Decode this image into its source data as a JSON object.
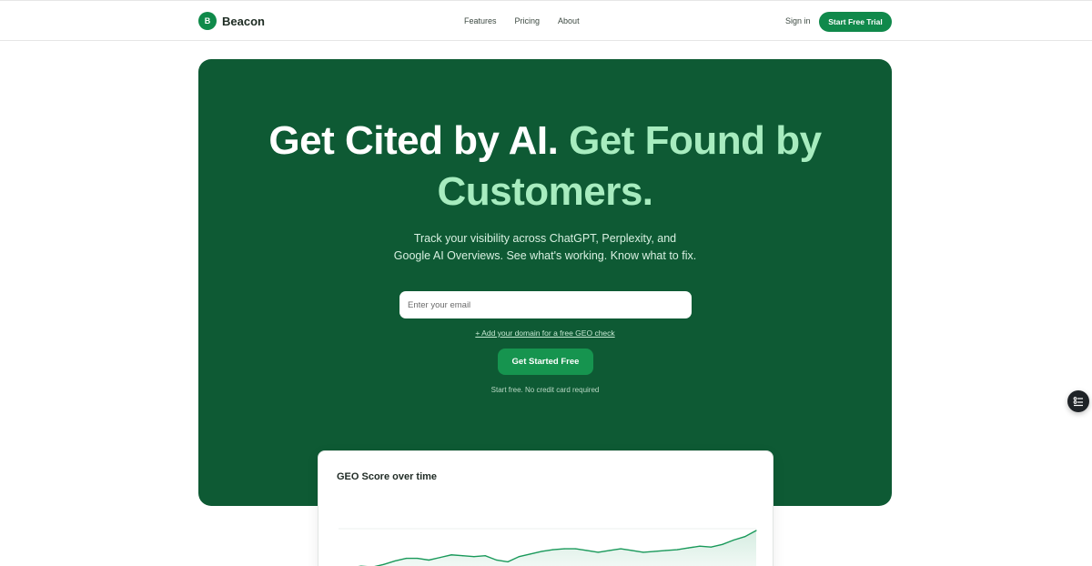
{
  "brand": {
    "initial": "B",
    "name": "Beacon"
  },
  "nav": {
    "links": [
      "Features",
      "Pricing",
      "About"
    ],
    "sign_in": "Sign in",
    "cta": "Start Free Trial"
  },
  "hero": {
    "headline_part1": "Get Cited by AI.",
    "headline_part2": "Get Found by Customers.",
    "subtitle_line1": "Track your visibility across ChatGPT, Perplexity, and",
    "subtitle_line2": "Google AI Overviews. See what's working. Know what to fix.",
    "email_placeholder": "Enter your email",
    "domain_link": "+ Add your domain for a free GEO check",
    "cta": "Get Started Free",
    "fineprint": "Start free. No credit card required"
  },
  "chart_data": {
    "type": "area",
    "title": "GEO Score over time",
    "xlabel": "",
    "ylabel": "",
    "grid": true,
    "values": [
      0,
      2,
      4,
      3,
      6,
      10,
      13,
      13,
      11,
      14,
      17,
      16,
      15,
      16,
      11,
      9,
      15,
      18,
      21,
      23,
      24,
      24,
      22,
      20,
      22,
      24,
      22,
      20,
      21,
      22,
      23,
      25,
      27,
      26,
      29,
      34,
      38,
      45
    ]
  },
  "colors": {
    "brand_green": "#0e5a34",
    "accent_green": "#a7ecbf",
    "button_green": "#10894b",
    "line_green": "#19995a"
  },
  "icons": {
    "widget": "list-check-icon"
  }
}
